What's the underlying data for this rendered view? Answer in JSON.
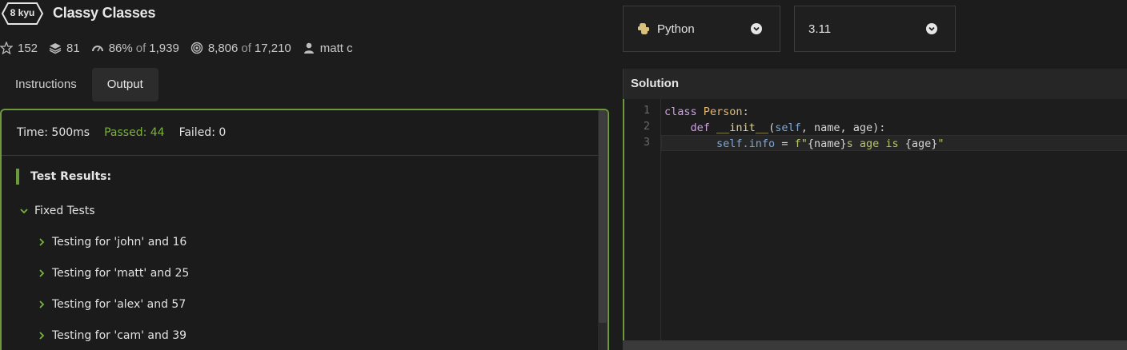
{
  "kata": {
    "rank": "8 kyu",
    "title": "Classy Classes",
    "stats": {
      "stars": "152",
      "collections": "81",
      "satisfaction": "86%",
      "satisfaction_of": "of",
      "satisfaction_votes": "1,939",
      "completed": "8,806",
      "completed_of": "of",
      "attempts": "17,210",
      "author": "matt c"
    }
  },
  "tabs": [
    {
      "label": "Instructions",
      "active": false
    },
    {
      "label": "Output",
      "active": true
    }
  ],
  "output": {
    "time": "Time: 500ms",
    "passed": "Passed: 44",
    "failed": "Failed: 0",
    "results_heading": "Test Results:",
    "group": "Fixed Tests",
    "tests": [
      "Testing for 'john' and 16",
      "Testing for 'matt' and 25",
      "Testing for 'alex' and 57",
      "Testing for 'cam' and 39"
    ]
  },
  "selectors": {
    "language": "Python",
    "version": "3.11"
  },
  "solution": {
    "header": "Solution",
    "line_numbers": [
      "1",
      "2",
      "3"
    ],
    "line1": {
      "kw": "class",
      "name": "Person",
      "colon": ":"
    },
    "line2": {
      "indent": "    ",
      "kw": "def",
      "fn": "__init__",
      "args_open": "(",
      "self": "self",
      "rest": ", name, age):"
    },
    "line3": {
      "indent": "        ",
      "self": "self",
      "attr": ".info",
      "eq": " = ",
      "fprefix": "f\"",
      "b1": "{name}",
      "mid": "s age is ",
      "b2": "{age}",
      "end": "\""
    }
  },
  "colors": {
    "accent_green": "#6c9a3b",
    "passed_green": "#7ab23f"
  }
}
